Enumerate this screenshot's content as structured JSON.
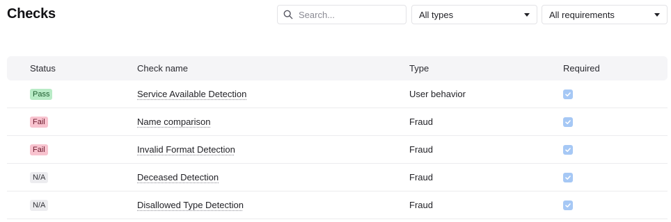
{
  "page": {
    "title": "Checks"
  },
  "filters": {
    "search_placeholder": "Search...",
    "search_value": "",
    "type_selected": "All types",
    "requirement_selected": "All requirements"
  },
  "table": {
    "headers": {
      "status": "Status",
      "name": "Check name",
      "type": "Type",
      "required": "Required"
    },
    "rows": [
      {
        "status": "Pass",
        "status_kind": "pass",
        "name": "Service Available Detection",
        "type": "User behavior",
        "required": true
      },
      {
        "status": "Fail",
        "status_kind": "fail",
        "name": "Name comparison",
        "type": "Fraud",
        "required": true
      },
      {
        "status": "Fail",
        "status_kind": "fail",
        "name": "Invalid Format Detection",
        "type": "Fraud",
        "required": true
      },
      {
        "status": "N/A",
        "status_kind": "na",
        "name": "Deceased Detection",
        "type": "Fraud",
        "required": true
      },
      {
        "status": "N/A",
        "status_kind": "na",
        "name": "Disallowed Type Detection",
        "type": "Fraud",
        "required": true
      }
    ]
  },
  "colors": {
    "pass_bg": "#b8ebc6",
    "fail_bg": "#f8c3cf",
    "na_bg": "#ececef",
    "checkbox": "#a6c8f5",
    "header_bg": "#f5f5f7"
  },
  "icons": {
    "search": "search-icon",
    "dropdown": "caret-down-icon",
    "check": "checkmark-icon"
  }
}
